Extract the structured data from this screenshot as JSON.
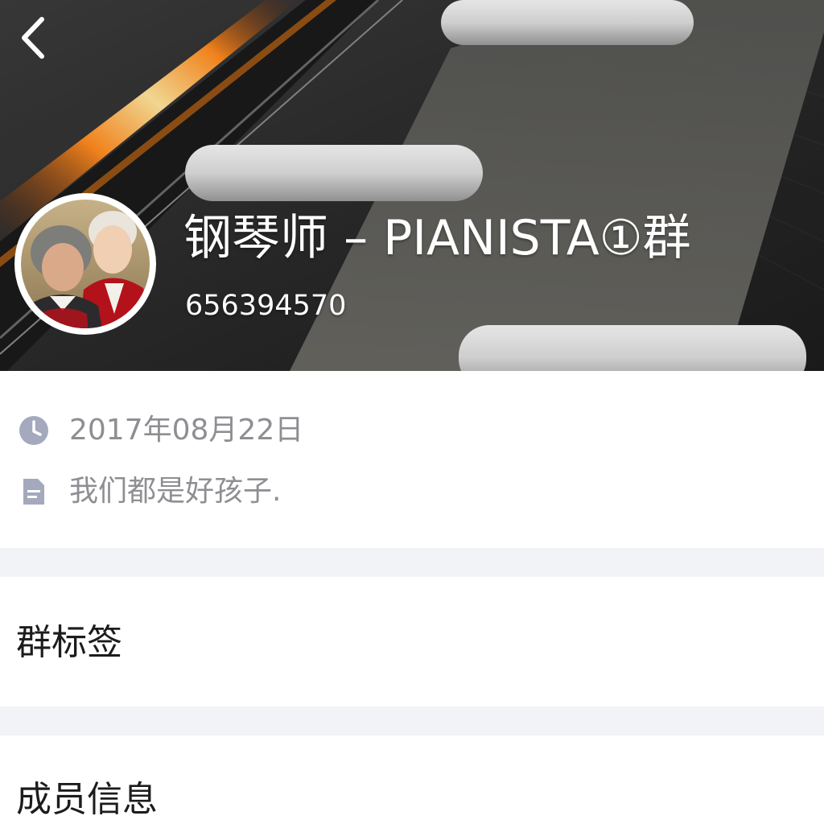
{
  "header": {
    "group_name": "钢琴师 – PIANISTA①群",
    "group_id": "656394570",
    "back_icon": "chevron-left-icon"
  },
  "info": {
    "created_date": "2017年08月22日",
    "created_icon": "clock-icon",
    "description": "我们都是好孩子.",
    "description_icon": "document-icon"
  },
  "sections": {
    "tags_label": "群标签",
    "members_label": "成员信息"
  },
  "colors": {
    "page_bg": "#ffffff",
    "divider_bg": "#f2f3f7",
    "secondary_text": "#8e8e93",
    "primary_text": "#1c1c1e",
    "icon_gray": "#a4a9bd"
  }
}
